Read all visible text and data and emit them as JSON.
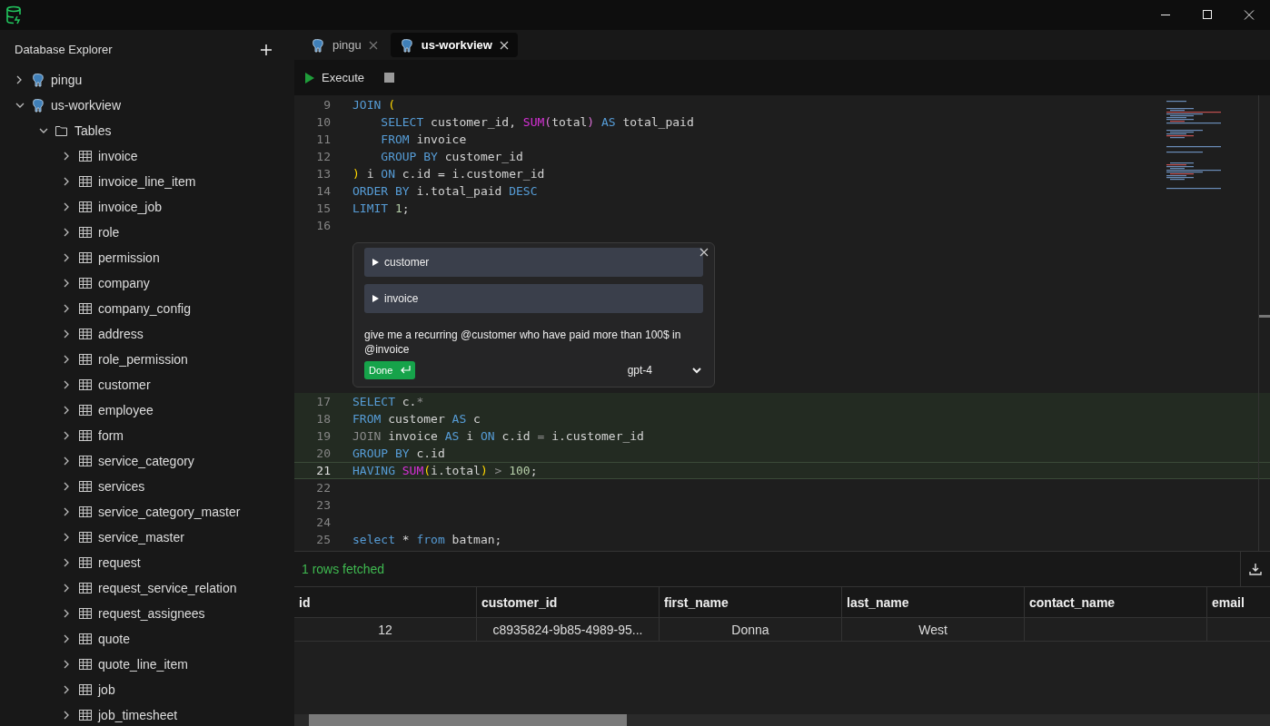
{
  "sidebar": {
    "title": "Database Explorer",
    "tree": [
      {
        "label": "pingu",
        "kind": "connection",
        "expanded": false
      },
      {
        "label": "us-workview",
        "kind": "connection",
        "expanded": true,
        "children": [
          {
            "label": "Tables",
            "kind": "folder",
            "expanded": true,
            "children": [
              {
                "label": "invoice",
                "kind": "table",
                "expanded": false
              },
              {
                "label": "invoice_line_item",
                "kind": "table",
                "expanded": false
              },
              {
                "label": "invoice_job",
                "kind": "table",
                "expanded": false
              },
              {
                "label": "role",
                "kind": "table",
                "expanded": false
              },
              {
                "label": "permission",
                "kind": "table",
                "expanded": false
              },
              {
                "label": "company",
                "kind": "table",
                "expanded": false
              },
              {
                "label": "company_config",
                "kind": "table",
                "expanded": false
              },
              {
                "label": "address",
                "kind": "table",
                "expanded": false
              },
              {
                "label": "role_permission",
                "kind": "table",
                "expanded": false
              },
              {
                "label": "customer",
                "kind": "table",
                "expanded": false
              },
              {
                "label": "employee",
                "kind": "table",
                "expanded": false
              },
              {
                "label": "form",
                "kind": "table",
                "expanded": false
              },
              {
                "label": "service_category",
                "kind": "table",
                "expanded": false
              },
              {
                "label": "services",
                "kind": "table",
                "expanded": false
              },
              {
                "label": "service_category_master",
                "kind": "table",
                "expanded": false
              },
              {
                "label": "service_master",
                "kind": "table",
                "expanded": false
              },
              {
                "label": "request",
                "kind": "table",
                "expanded": false
              },
              {
                "label": "request_service_relation",
                "kind": "table",
                "expanded": false
              },
              {
                "label": "request_assignees",
                "kind": "table",
                "expanded": false
              },
              {
                "label": "quote",
                "kind": "table",
                "expanded": false
              },
              {
                "label": "quote_line_item",
                "kind": "table",
                "expanded": false
              },
              {
                "label": "job",
                "kind": "table",
                "expanded": false
              },
              {
                "label": "job_timesheet",
                "kind": "table",
                "expanded": false
              }
            ]
          }
        ]
      }
    ]
  },
  "tabs": [
    {
      "label": "pingu",
      "selected": false
    },
    {
      "label": "us-workview",
      "selected": true
    }
  ],
  "toolbar": {
    "execute": "Execute"
  },
  "editor": {
    "lines_before": [
      {
        "n": "9",
        "added": false,
        "current": false,
        "tokens": [
          {
            "kind": "keyword",
            "text": "JOIN "
          },
          {
            "kind": "paren",
            "text": "("
          }
        ]
      },
      {
        "n": "10",
        "added": false,
        "current": false,
        "tokens": [
          {
            "kind": "keyword",
            "text": "    SELECT "
          },
          {
            "kind": "plain",
            "text": "customer_id, "
          },
          {
            "kind": "function",
            "text": "SUM"
          },
          {
            "kind": "paren2",
            "text": "("
          },
          {
            "kind": "plain",
            "text": "total"
          },
          {
            "kind": "paren2",
            "text": ")"
          },
          {
            "kind": "keyword",
            "text": " AS "
          },
          {
            "kind": "plain",
            "text": "total_paid"
          }
        ]
      },
      {
        "n": "11",
        "added": false,
        "current": false,
        "tokens": [
          {
            "kind": "keyword",
            "text": "    FROM "
          },
          {
            "kind": "plain",
            "text": "invoice"
          }
        ]
      },
      {
        "n": "12",
        "added": false,
        "current": false,
        "tokens": [
          {
            "kind": "keyword",
            "text": "    GROUP BY "
          },
          {
            "kind": "plain",
            "text": "customer_id"
          }
        ]
      },
      {
        "n": "13",
        "added": false,
        "current": false,
        "tokens": [
          {
            "kind": "paren",
            "text": ")"
          },
          {
            "kind": "plain",
            "text": " i "
          },
          {
            "kind": "keyword",
            "text": "ON "
          },
          {
            "kind": "plain",
            "text": "c.id = i.customer_id"
          }
        ]
      },
      {
        "n": "14",
        "added": false,
        "current": false,
        "tokens": [
          {
            "kind": "keyword",
            "text": "ORDER BY "
          },
          {
            "kind": "plain",
            "text": "i.total_paid "
          },
          {
            "kind": "keyword",
            "text": "DESC"
          }
        ]
      },
      {
        "n": "15",
        "added": false,
        "current": false,
        "tokens": [
          {
            "kind": "keyword",
            "text": "LIMIT "
          },
          {
            "kind": "number",
            "text": "1"
          },
          {
            "kind": "plain",
            "text": ";"
          }
        ]
      },
      {
        "n": "16",
        "added": false,
        "current": false
      }
    ],
    "assistant": {
      "contexts": [
        {
          "label": "customer",
          "expanded": false
        },
        {
          "label": "invoice",
          "expanded": false
        }
      ],
      "prompt": "give me a recurring @customer who have paid more than 100$ in @invoice",
      "done": "Done",
      "model": "gpt-4"
    },
    "lines_after": [
      {
        "n": "17",
        "added": true,
        "current": false,
        "tokens": [
          {
            "kind": "keyword",
            "text": "SELECT "
          },
          {
            "kind": "plain",
            "text": "c."
          },
          {
            "kind": "dim",
            "text": "*"
          }
        ]
      },
      {
        "n": "18",
        "added": true,
        "current": false,
        "tokens": [
          {
            "kind": "keyword",
            "text": "FROM "
          },
          {
            "kind": "plain",
            "text": "customer "
          },
          {
            "kind": "keyword",
            "text": "AS "
          },
          {
            "kind": "plain",
            "text": "c"
          }
        ]
      },
      {
        "n": "19",
        "added": true,
        "current": false,
        "tokens": [
          {
            "kind": "dim",
            "text": "JOIN "
          },
          {
            "kind": "plain",
            "text": "invoice "
          },
          {
            "kind": "keyword",
            "text": "AS "
          },
          {
            "kind": "plain",
            "text": "i "
          },
          {
            "kind": "keyword",
            "text": "ON "
          },
          {
            "kind": "plain",
            "text": "c.id "
          },
          {
            "kind": "dim",
            "text": "="
          },
          {
            "kind": "plain",
            "text": " i.customer_id"
          }
        ]
      },
      {
        "n": "20",
        "added": true,
        "current": false,
        "tokens": [
          {
            "kind": "keyword",
            "text": "GROUP BY "
          },
          {
            "kind": "plain",
            "text": "c.id"
          }
        ]
      },
      {
        "n": "21",
        "added": true,
        "current": true,
        "tokens": [
          {
            "kind": "keyword",
            "text": "HAVING "
          },
          {
            "kind": "function",
            "text": "SUM"
          },
          {
            "kind": "paren",
            "text": "("
          },
          {
            "kind": "plain",
            "text": "i.total"
          },
          {
            "kind": "paren",
            "text": ")"
          },
          {
            "kind": "dim",
            "text": " > "
          },
          {
            "kind": "number",
            "text": "100"
          },
          {
            "kind": "plain",
            "text": ";"
          }
        ]
      },
      {
        "n": "22",
        "added": false,
        "current": false
      },
      {
        "n": "23",
        "added": false,
        "current": false
      },
      {
        "n": "24",
        "added": false,
        "current": false
      },
      {
        "n": "25",
        "added": false,
        "current": false,
        "tokens": [
          {
            "kind": "keyword",
            "text": "select "
          },
          {
            "kind": "plain",
            "text": "* "
          },
          {
            "kind": "keyword",
            "text": "from "
          },
          {
            "kind": "plain",
            "text": "batman;"
          }
        ]
      }
    ]
  },
  "results": {
    "status": "1 rows fetched",
    "columns": [
      "id",
      "customer_id",
      "first_name",
      "last_name",
      "contact_name",
      "email"
    ],
    "rows": [
      [
        "12",
        "c8935824-9b85-4989-95...",
        "Donna",
        "West",
        null,
        null
      ]
    ]
  }
}
